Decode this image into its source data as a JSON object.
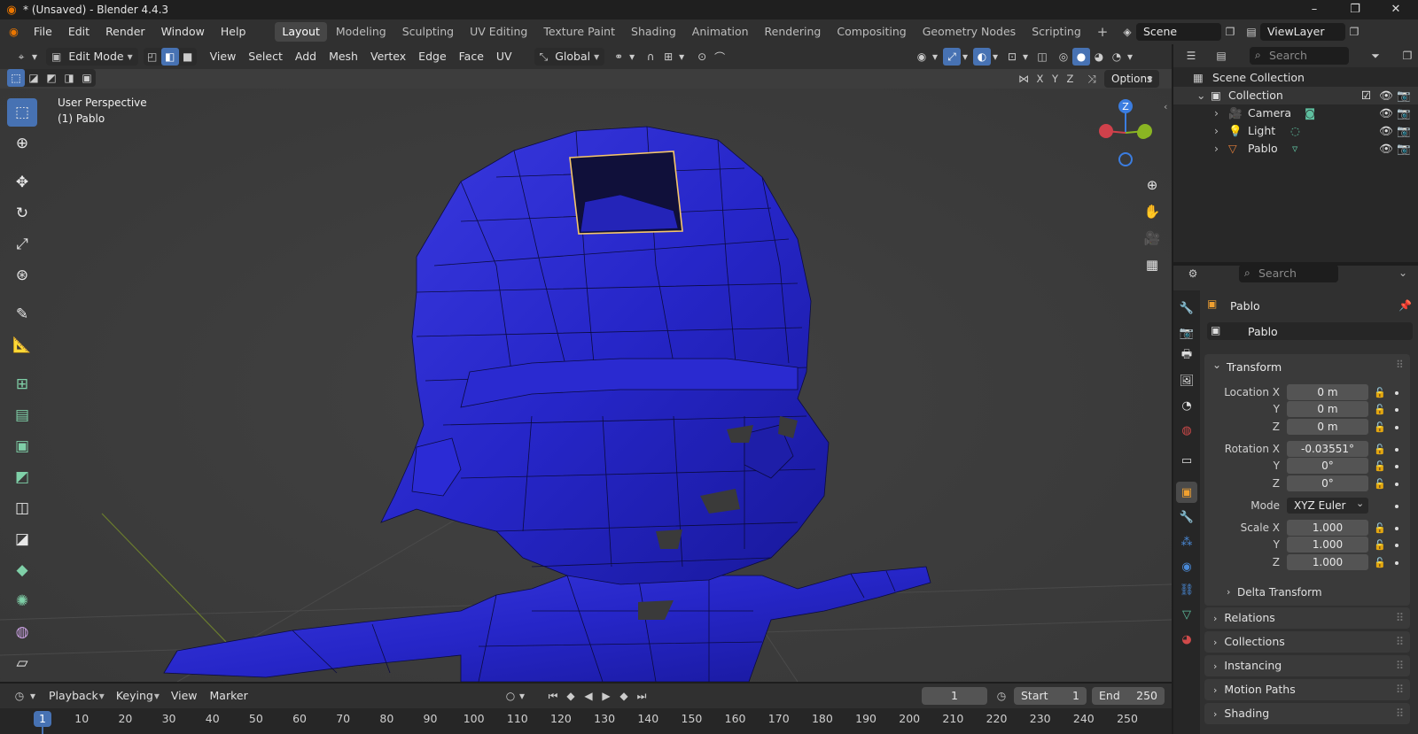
{
  "window": {
    "title": "* (Unsaved) - Blender 4.4.3",
    "minimize_icon": "minimize-icon",
    "maximize_icon": "restore-icon",
    "close_icon": "close-icon"
  },
  "menu": {
    "items": [
      "File",
      "Edit",
      "Render",
      "Window",
      "Help"
    ],
    "workspaces": [
      "Layout",
      "Modeling",
      "Sculpting",
      "UV Editing",
      "Texture Paint",
      "Shading",
      "Animation",
      "Rendering",
      "Compositing",
      "Geometry Nodes",
      "Scripting"
    ],
    "active_workspace": "Layout",
    "add_tab": "+",
    "scene": "Scene",
    "view_layer": "ViewLayer"
  },
  "viewport": {
    "mode": "Edit Mode",
    "menus": [
      "View",
      "Select",
      "Add",
      "Mesh",
      "Vertex",
      "Edge",
      "Face",
      "UV"
    ],
    "orientation": "Global",
    "options_label": "Options",
    "axis_labels": [
      "X",
      "Y",
      "Z"
    ],
    "overlay_line1": "User Perspective",
    "overlay_line2": "(1) Pablo",
    "gizmo_z": "Z",
    "mesh_color": "#2323c6",
    "selection_color": "#f5a623"
  },
  "tools": [
    "select-box-icon",
    "cursor-icon",
    "move-icon",
    "rotate-icon",
    "scale-icon",
    "transform-icon",
    "annotate-icon",
    "measure-icon",
    "add-cube-icon",
    "extrude-icon",
    "inset-icon",
    "bevel-icon",
    "loop-cut-icon",
    "knife-icon",
    "poly-build-icon",
    "spin-icon",
    "smooth-icon",
    "shear-icon"
  ],
  "outliner": {
    "search_placeholder": "Search",
    "scene_collection": "Scene Collection",
    "collection": "Collection",
    "objects": [
      {
        "name": "Camera",
        "icon": "camera-icon",
        "color": "#e07d3a"
      },
      {
        "name": "Light",
        "icon": "light-icon",
        "color": "#e07d3a"
      },
      {
        "name": "Pablo",
        "icon": "mesh-icon",
        "color": "#e07d3a"
      }
    ]
  },
  "properties": {
    "search_placeholder": "Search",
    "object_name": "Pablo",
    "object_field": "Pablo",
    "transform_label": "Transform",
    "location_label": "Location X",
    "rotation_label": "Rotation X",
    "scale_label": "Scale X",
    "y_label": "Y",
    "z_label": "Z",
    "mode_label": "Mode",
    "location": [
      "0 m",
      "0 m",
      "0 m"
    ],
    "rotation": [
      "-0.03551°",
      "0°",
      "0°"
    ],
    "mode": "XYZ Euler",
    "scale": [
      "1.000",
      "1.000",
      "1.000"
    ],
    "delta_transform": "Delta Transform",
    "subpanels": [
      "Relations",
      "Collections",
      "Instancing",
      "Motion Paths",
      "Shading"
    ]
  },
  "timeline": {
    "menus": [
      "Playback",
      "Keying",
      "View",
      "Marker"
    ],
    "current_frame": "1",
    "start_label": "Start",
    "start": "1",
    "end_label": "End",
    "end": "250",
    "ruler": [
      "1",
      "10",
      "20",
      "30",
      "40",
      "50",
      "60",
      "70",
      "80",
      "90",
      "100",
      "110",
      "120",
      "130",
      "140",
      "150",
      "160",
      "170",
      "180",
      "190",
      "200",
      "210",
      "220",
      "230",
      "240",
      "250"
    ]
  }
}
